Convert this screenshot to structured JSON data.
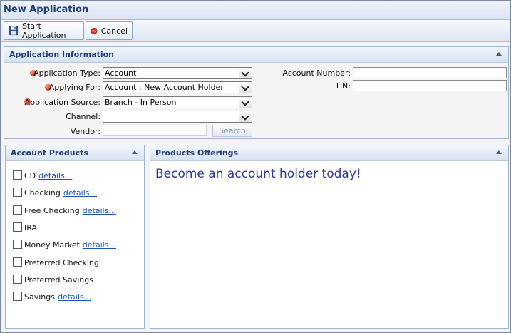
{
  "window": {
    "title": "New Application"
  },
  "toolbar": {
    "start_label": "Start Application",
    "cancel_label": "Cancel"
  },
  "info": {
    "title": "Application Information",
    "application_type": {
      "label": "Application Type:",
      "value": "Account",
      "required": true
    },
    "applying_for": {
      "label": "Applying For:",
      "value": "Account : New Account Holder",
      "required": true
    },
    "application_source": {
      "label": "Application Source:",
      "value": "Branch - In Person",
      "required": true
    },
    "channel": {
      "label": "Channel:",
      "value": ""
    },
    "vendor": {
      "label": "Vendor:",
      "value": "",
      "search_label": "Search"
    },
    "account_number": {
      "label": "Account Number:",
      "value": ""
    },
    "tin": {
      "label": "TIN:",
      "value": ""
    }
  },
  "products": {
    "title": "Account Products",
    "details_label": "details...",
    "items": [
      {
        "label": "CD",
        "has_details": true
      },
      {
        "label": "Checking",
        "has_details": true
      },
      {
        "label": "Free Checking",
        "has_details": true
      },
      {
        "label": "IRA",
        "has_details": false
      },
      {
        "label": "Money Market",
        "has_details": true
      },
      {
        "label": "Preferred Checking",
        "has_details": false
      },
      {
        "label": "Preferred Savings",
        "has_details": false
      },
      {
        "label": "Savings",
        "has_details": true
      }
    ]
  },
  "offerings": {
    "title": "Products Offerings",
    "message": "Become an account holder today!"
  },
  "colors": {
    "title_text": "#1f3c78",
    "required_dot": "#d8431c",
    "link": "#1b53b8",
    "offer_text": "#2f36a1"
  }
}
